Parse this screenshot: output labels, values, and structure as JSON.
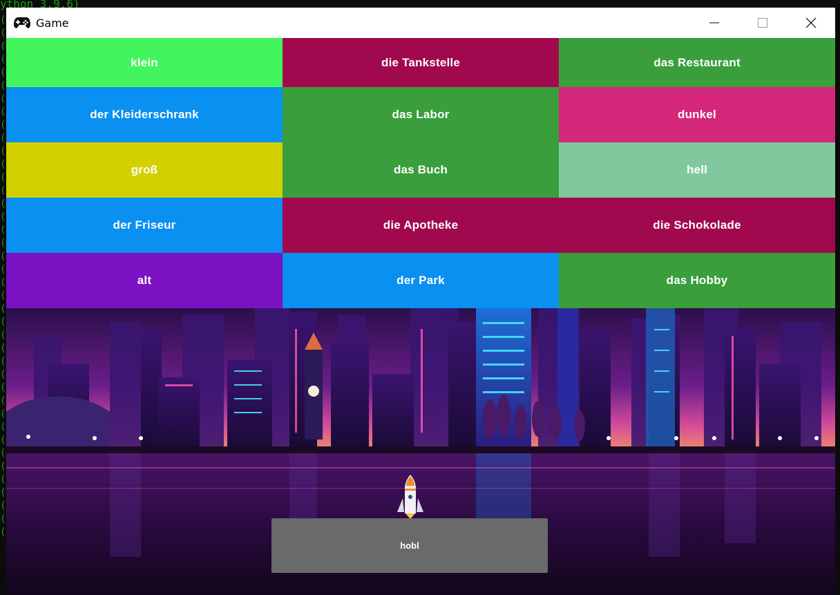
{
  "terminal": {
    "top_text": "ython 3.9.6)"
  },
  "window": {
    "title": "Game",
    "icon": "gamepad-icon"
  },
  "controls": {
    "minimize": "minimize-icon",
    "maximize": "maximize-icon",
    "close": "close-icon"
  },
  "tiles": [
    {
      "label": "klein",
      "color": "#42f55c"
    },
    {
      "label": "die Tankstelle",
      "color": "#a1094f"
    },
    {
      "label": "das Restaurant",
      "color": "#3a9e3d"
    },
    {
      "label": "der Kleiderschrank",
      "color": "#0a90f0"
    },
    {
      "label": "das Labor",
      "color": "#3a9e3d"
    },
    {
      "label": "dunkel",
      "color": "#d4267a"
    },
    {
      "label": "groß",
      "color": "#d2d000"
    },
    {
      "label": "das Buch",
      "color": "#3a9e3d"
    },
    {
      "label": "hell",
      "color": "#80c89e"
    },
    {
      "label": "der Friseur",
      "color": "#0a90f0"
    },
    {
      "label": "die Apotheke",
      "color": "#a1094f"
    },
    {
      "label": "die Schokolade",
      "color": "#a1094f"
    },
    {
      "label": "alt",
      "color": "#7a11c2"
    },
    {
      "label": "der Park",
      "color": "#0a90f0"
    },
    {
      "label": "das Hobby",
      "color": "#3a9e3d"
    }
  ],
  "player": {
    "icon": "rocket-icon"
  },
  "answer": {
    "text": "hobl",
    "color": "#6a6a6a"
  }
}
